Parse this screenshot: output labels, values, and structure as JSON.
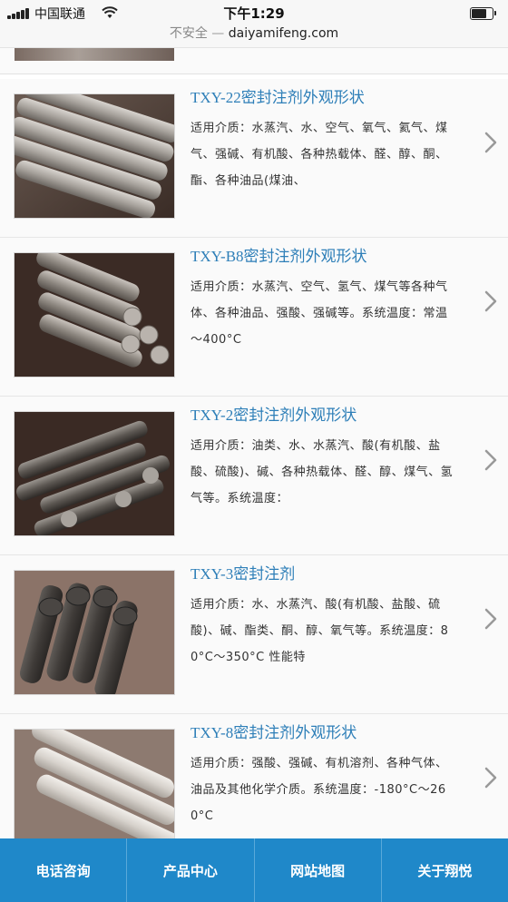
{
  "status_bar": {
    "carrier": "中国联通",
    "time": "下午1:29"
  },
  "url_bar": {
    "security_label": "不安全",
    "separator": "—",
    "url": "daiyamifeng.com"
  },
  "products": [
    {
      "title": "TXY-22密封注剂外观形状",
      "description": "适用介质：水蒸汽、水、空气、氧气、氦气、煤气、强碱、有机酸、各种热载体、醛、醇、酮、酯、各种油品(煤油、"
    },
    {
      "title": "TXY-B8密封注剂外观形状",
      "description": "适用介质：水蒸汽、空气、氢气、煤气等各种气体、各种油品、强酸、强碱等。系统温度：常温～400°C"
    },
    {
      "title": "TXY-2密封注剂外观形状",
      "description": "适用介质：油类、水、水蒸汽、酸(有机酸、盐酸、硫酸)、碱、各种热载体、醛、醇、煤气、氢气等。系统温度："
    },
    {
      "title": "TXY-3密封注剂",
      "description": "适用介质：水、水蒸汽、酸(有机酸、盐酸、硫酸)、碱、酯类、酮、醇、氧气等。系统温度：80°C～350°C 性能特"
    },
    {
      "title": "TXY-8密封注剂外观形状",
      "description": "适用介质：强酸、强碱、有机溶剂、各种气体、油品及其他化学介质。系统温度：-180°C～260°C"
    }
  ],
  "bottom_nav": [
    {
      "label": "电话咨询"
    },
    {
      "label": "产品中心"
    },
    {
      "label": "网站地图"
    },
    {
      "label": "关于翔悦"
    }
  ],
  "colors": {
    "accent": "#1f88c9",
    "title_link": "#2e7fb8"
  }
}
